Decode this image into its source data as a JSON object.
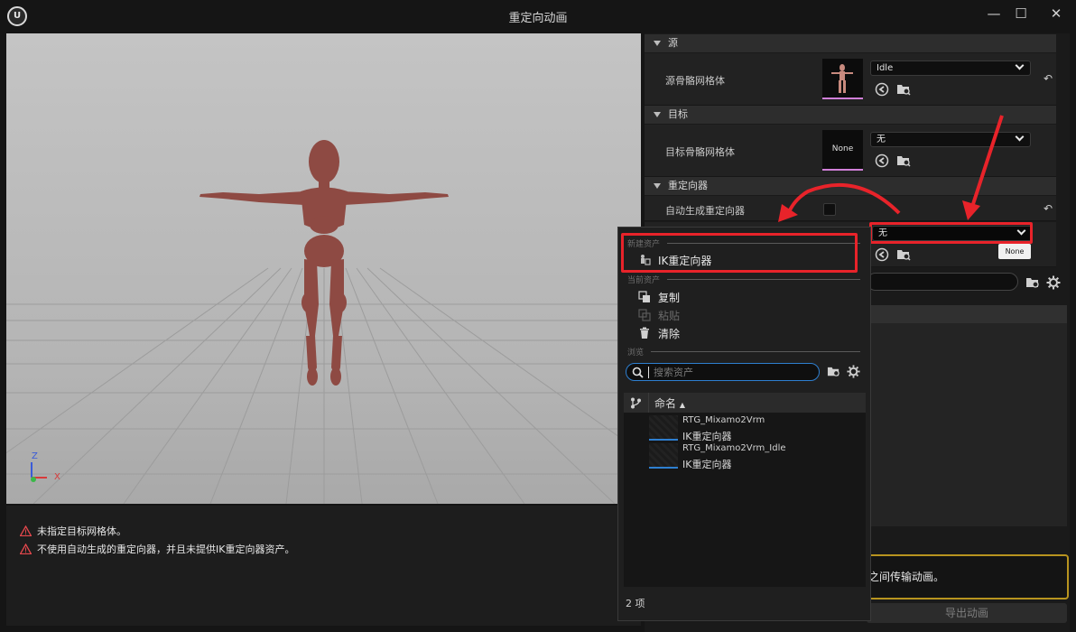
{
  "window": {
    "title": "重定向动画",
    "logo_text": "U",
    "minimize": "—",
    "maximize": "☐",
    "close": "✕"
  },
  "viewport": {
    "axis_labels": {
      "x": "X",
      "z": "Z"
    }
  },
  "messages": [
    {
      "text": "未指定目标网格体。"
    },
    {
      "text": "不使用自动生成的重定向器，并且未提供IK重定向器资产。"
    }
  ],
  "details": {
    "source": {
      "category": "源",
      "label": "源骨骼网格体",
      "value": "Idle"
    },
    "target": {
      "category": "目标",
      "label": "目标骨骼网格体",
      "thumb_text": "None",
      "value": "无"
    },
    "retargeter": {
      "category": "重定向器",
      "auto_label": "自动生成重定向器",
      "value": "无",
      "tooltip": "None"
    }
  },
  "popup": {
    "sections": {
      "new_asset": "新建资产",
      "current_asset": "当前资产",
      "browse": "浏览"
    },
    "new_item": "IK重定向器",
    "copy": "复制",
    "paste": "粘贴",
    "clear": "清除",
    "search_placeholder": "搜索资产",
    "column_name": "命名",
    "sort_arrow": "▲",
    "assets": [
      {
        "name": "RTG_Mixamo2Vrm",
        "type": "IK重定向器"
      },
      {
        "name": "RTG_Mixamo2Vrm_Idle",
        "type": "IK重定向器"
      }
    ],
    "count": "2 项"
  },
  "lower_panel": {
    "info_text": "之间传输动画。",
    "export_button": "导出动画"
  },
  "colors": {
    "highlight_red": "#e8232a",
    "accent_blue": "#2e7fd0",
    "warning_gold": "#b8941f",
    "mannequin": "#8e4a43"
  }
}
